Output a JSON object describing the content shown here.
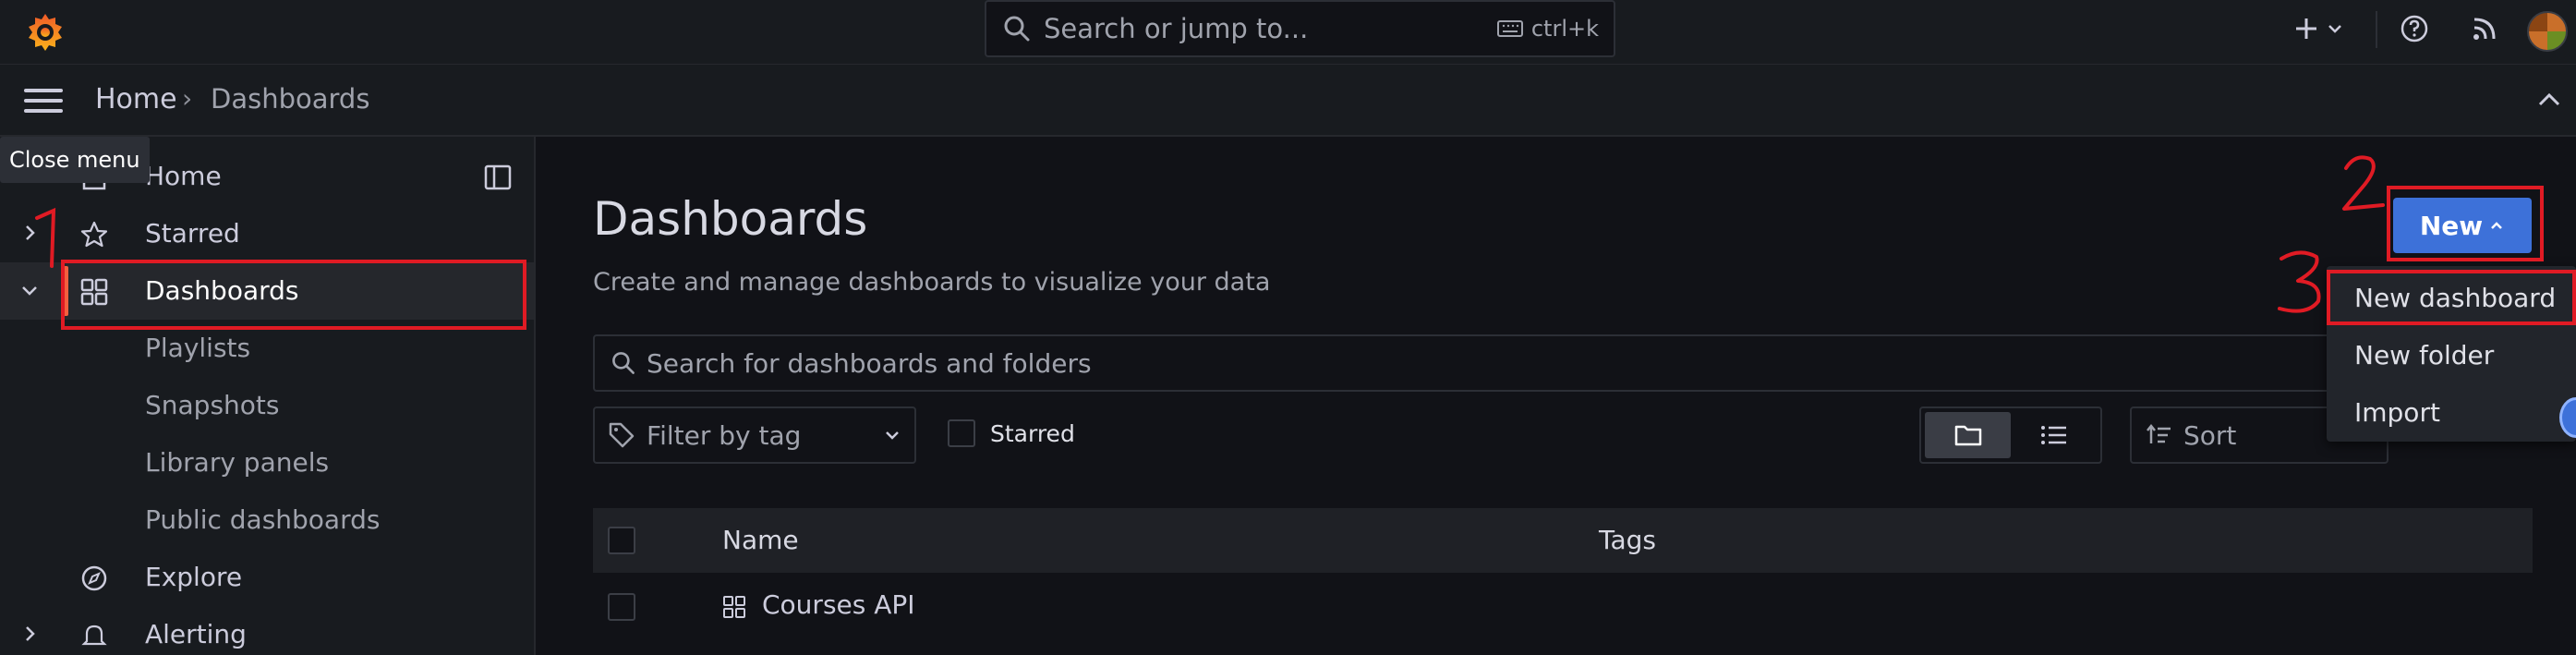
{
  "topbar": {
    "search_placeholder": "Search or jump to...",
    "shortcut": "ctrl+k"
  },
  "breadcrumb": {
    "home": "Home",
    "current": "Dashboards",
    "separator": "›"
  },
  "tooltip": "Close menu",
  "sidebar": {
    "items": [
      {
        "label": "Home",
        "icon": "home-icon"
      },
      {
        "label": "Starred",
        "icon": "star-icon"
      },
      {
        "label": "Dashboards",
        "icon": "dashboards-grid-icon"
      },
      {
        "label": "Playlists"
      },
      {
        "label": "Snapshots"
      },
      {
        "label": "Library panels"
      },
      {
        "label": "Public dashboards"
      },
      {
        "label": "Explore",
        "icon": "compass-icon"
      },
      {
        "label": "Alerting",
        "icon": "bell-icon"
      }
    ]
  },
  "main": {
    "title": "Dashboards",
    "subtitle": "Create and manage dashboards to visualize your data",
    "search_placeholder": "Search for dashboards and folders",
    "tag_filter_placeholder": "Filter by tag",
    "starred_label": "Starred",
    "sort_placeholder": "Sort",
    "new_button": "New",
    "table": {
      "columns": [
        "Name",
        "Tags"
      ],
      "rows": [
        {
          "name": "Courses API",
          "tags": ""
        }
      ]
    }
  },
  "new_menu": {
    "items": [
      "New dashboard",
      "New folder",
      "Import"
    ]
  },
  "annotations": [
    "1",
    "2",
    "3"
  ],
  "colors": {
    "background": "#111217",
    "panel": "#181b1f",
    "primary_button": "#3d71d9",
    "active_indicator": "#f55f3e",
    "annotation_red": "#e01b24"
  }
}
